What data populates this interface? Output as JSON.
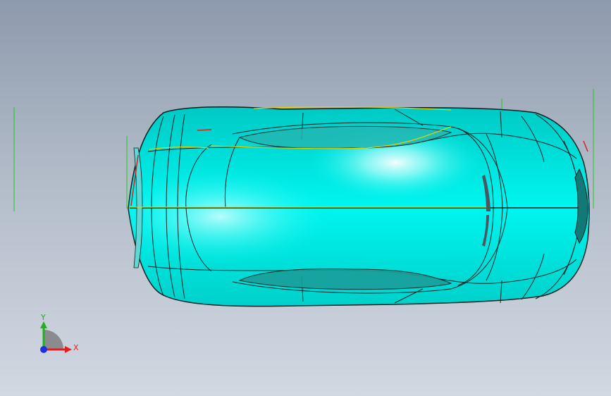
{
  "viewport": {
    "background_top": "#8e9aad",
    "background_bottom": "#d2d8e2"
  },
  "model": {
    "surface_color": "#00f5f0",
    "edge_color": "#0a2020",
    "highlight_color": "#ffffff",
    "construction_line_color": "#22c822",
    "accent_curve_color": "#e6d200",
    "marker_color": "#d82020"
  },
  "triad": {
    "x_label": "X",
    "y_label": "Y",
    "x_color": "#e02020",
    "y_color": "#20b020",
    "z_color": "#2030e0"
  }
}
